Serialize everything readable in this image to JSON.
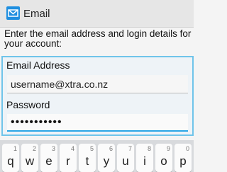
{
  "header": {
    "title": "Email",
    "icon": "mail-envelope-icon",
    "icon_color": "#1f8fe0"
  },
  "intro_text": "Enter the email address and login details for your account:",
  "form": {
    "email_label": "Email Address",
    "email_value": "username@xtra.co.nz",
    "password_label": "Password",
    "password_value": "•••••••••••",
    "focus_color": "#6fc4ea"
  },
  "keyboard": {
    "keys": [
      {
        "num": "1",
        "letter": "q"
      },
      {
        "num": "2",
        "letter": "w"
      },
      {
        "num": "3",
        "letter": "e"
      },
      {
        "num": "4",
        "letter": "r"
      },
      {
        "num": "5",
        "letter": "t"
      },
      {
        "num": "6",
        "letter": "y"
      },
      {
        "num": "7",
        "letter": "u"
      },
      {
        "num": "8",
        "letter": "i"
      },
      {
        "num": "9",
        "letter": "o"
      },
      {
        "num": "0",
        "letter": "p"
      }
    ]
  }
}
